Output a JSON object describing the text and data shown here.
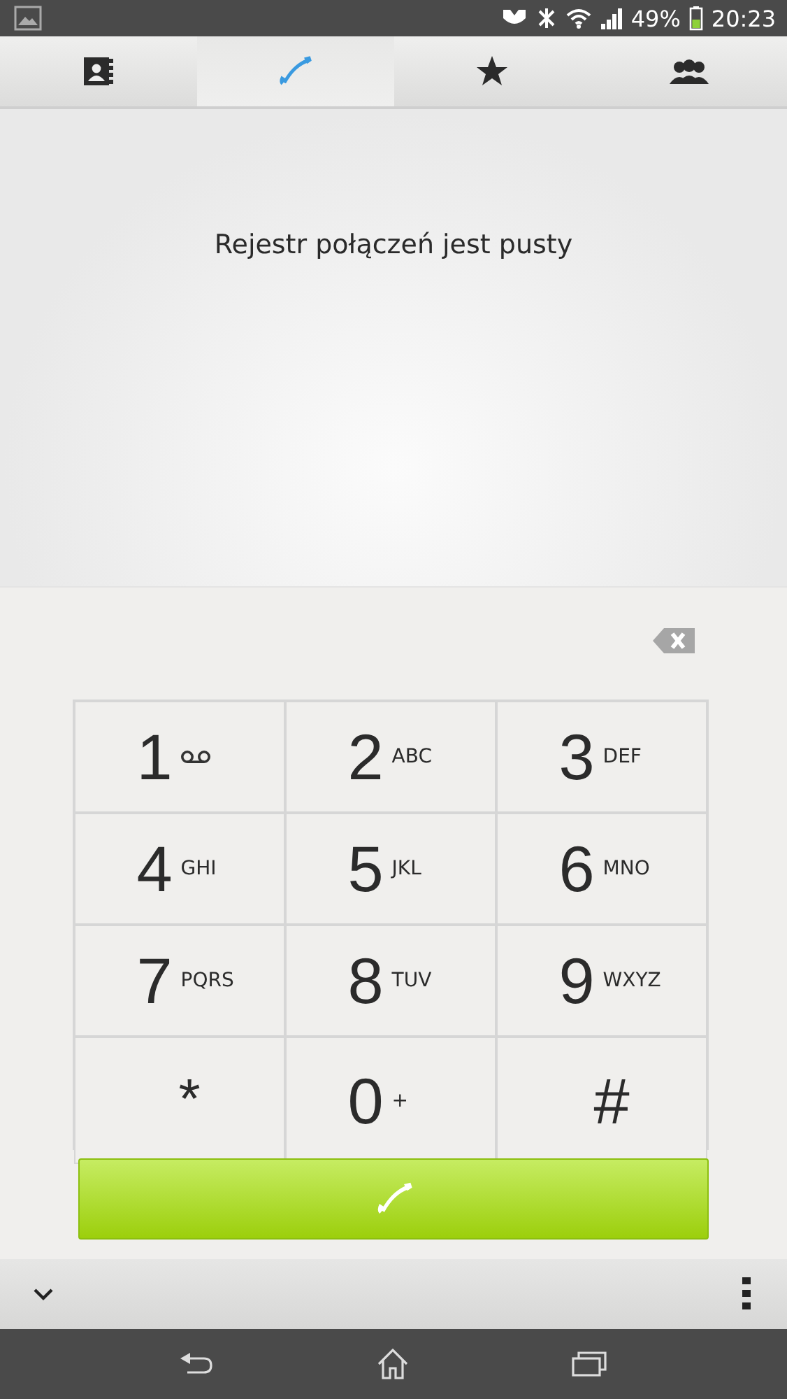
{
  "status_bar": {
    "battery": "49%",
    "time": "20:23"
  },
  "tabs": [
    {
      "kind": "contacts",
      "selected": false
    },
    {
      "kind": "calls",
      "selected": true
    },
    {
      "kind": "favorites",
      "selected": false
    },
    {
      "kind": "groups",
      "selected": false
    }
  ],
  "empty_message": "Rejestr połączeń jest pusty",
  "keypad": [
    {
      "digit": "1",
      "kind": "voicemail"
    },
    {
      "digit": "2",
      "letters": "ABC"
    },
    {
      "digit": "3",
      "letters": "DEF"
    },
    {
      "digit": "4",
      "letters": "GHI"
    },
    {
      "digit": "5",
      "letters": "JKL"
    },
    {
      "digit": "6",
      "letters": "MNO"
    },
    {
      "digit": "7",
      "letters": "PQRS"
    },
    {
      "digit": "8",
      "letters": "TUV"
    },
    {
      "digit": "9",
      "letters": "WXYZ"
    },
    {
      "digit": "*"
    },
    {
      "digit": "0",
      "letters": "+"
    },
    {
      "digit": "#"
    }
  ]
}
